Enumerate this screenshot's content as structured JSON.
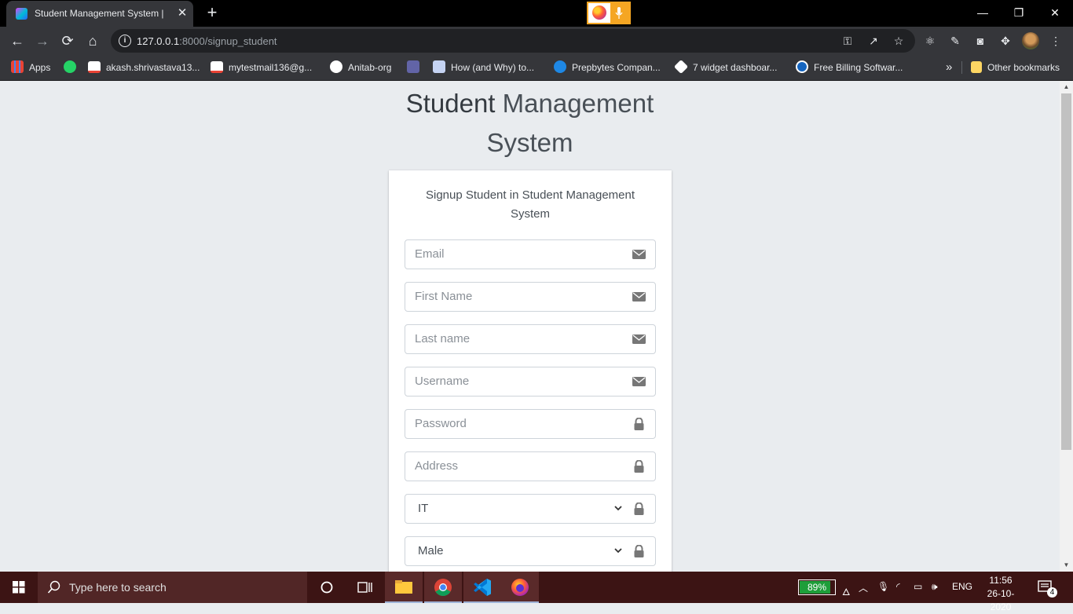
{
  "browser": {
    "tab_title": "Student Management System | Signup Student",
    "new_tab": "+",
    "url_host": "127.0.0.1",
    "url_rest": ":8000/signup_student",
    "window": {
      "minimize": "—",
      "restore": "❐",
      "close": "✕"
    }
  },
  "bookmarks": [
    {
      "label": "Apps",
      "color": "#ea4335"
    },
    {
      "label": "",
      "color": "#25d366"
    },
    {
      "label": "akash.shrivastava13...",
      "color": "#ffffff"
    },
    {
      "label": "mytestmail136@g...",
      "color": "#ffffff"
    },
    {
      "label": "Anitab-org",
      "color": "#ffffff"
    },
    {
      "label": "",
      "color": "#6264a7"
    },
    {
      "label": "How (and Why) to...",
      "color": "#c5d3f3"
    },
    {
      "label": "Prepbytes Compan...",
      "color": "#1e88e5"
    },
    {
      "label": "7 widget dashboar...",
      "color": "#ffffff"
    },
    {
      "label": "Free Billing Softwar...",
      "color": "#1565c0"
    }
  ],
  "bookmarks_more": "»",
  "other_bookmarks": "Other bookmarks",
  "page": {
    "brand_bold": "Student",
    "brand_rest_line1": " Management",
    "brand_line2": "System",
    "login_msg": "Signup Student in Student Management System",
    "fields": [
      {
        "placeholder": "Email",
        "icon": "envelope-icon"
      },
      {
        "placeholder": "First Name",
        "icon": "envelope-icon"
      },
      {
        "placeholder": "Last name",
        "icon": "envelope-icon"
      },
      {
        "placeholder": "Username",
        "icon": "envelope-icon"
      },
      {
        "placeholder": "Password",
        "icon": "lock-icon"
      },
      {
        "placeholder": "Address",
        "icon": "lock-icon"
      }
    ],
    "selects": [
      {
        "value": "IT",
        "icon": "lock-icon"
      },
      {
        "value": "Male",
        "icon": "lock-icon"
      }
    ]
  },
  "taskbar": {
    "search_placeholder": "Type here to search",
    "battery": "89%",
    "battery_level": 0.89,
    "language": "ENG",
    "time": "11:56",
    "date": "26-10-2020",
    "notifications": "4"
  }
}
